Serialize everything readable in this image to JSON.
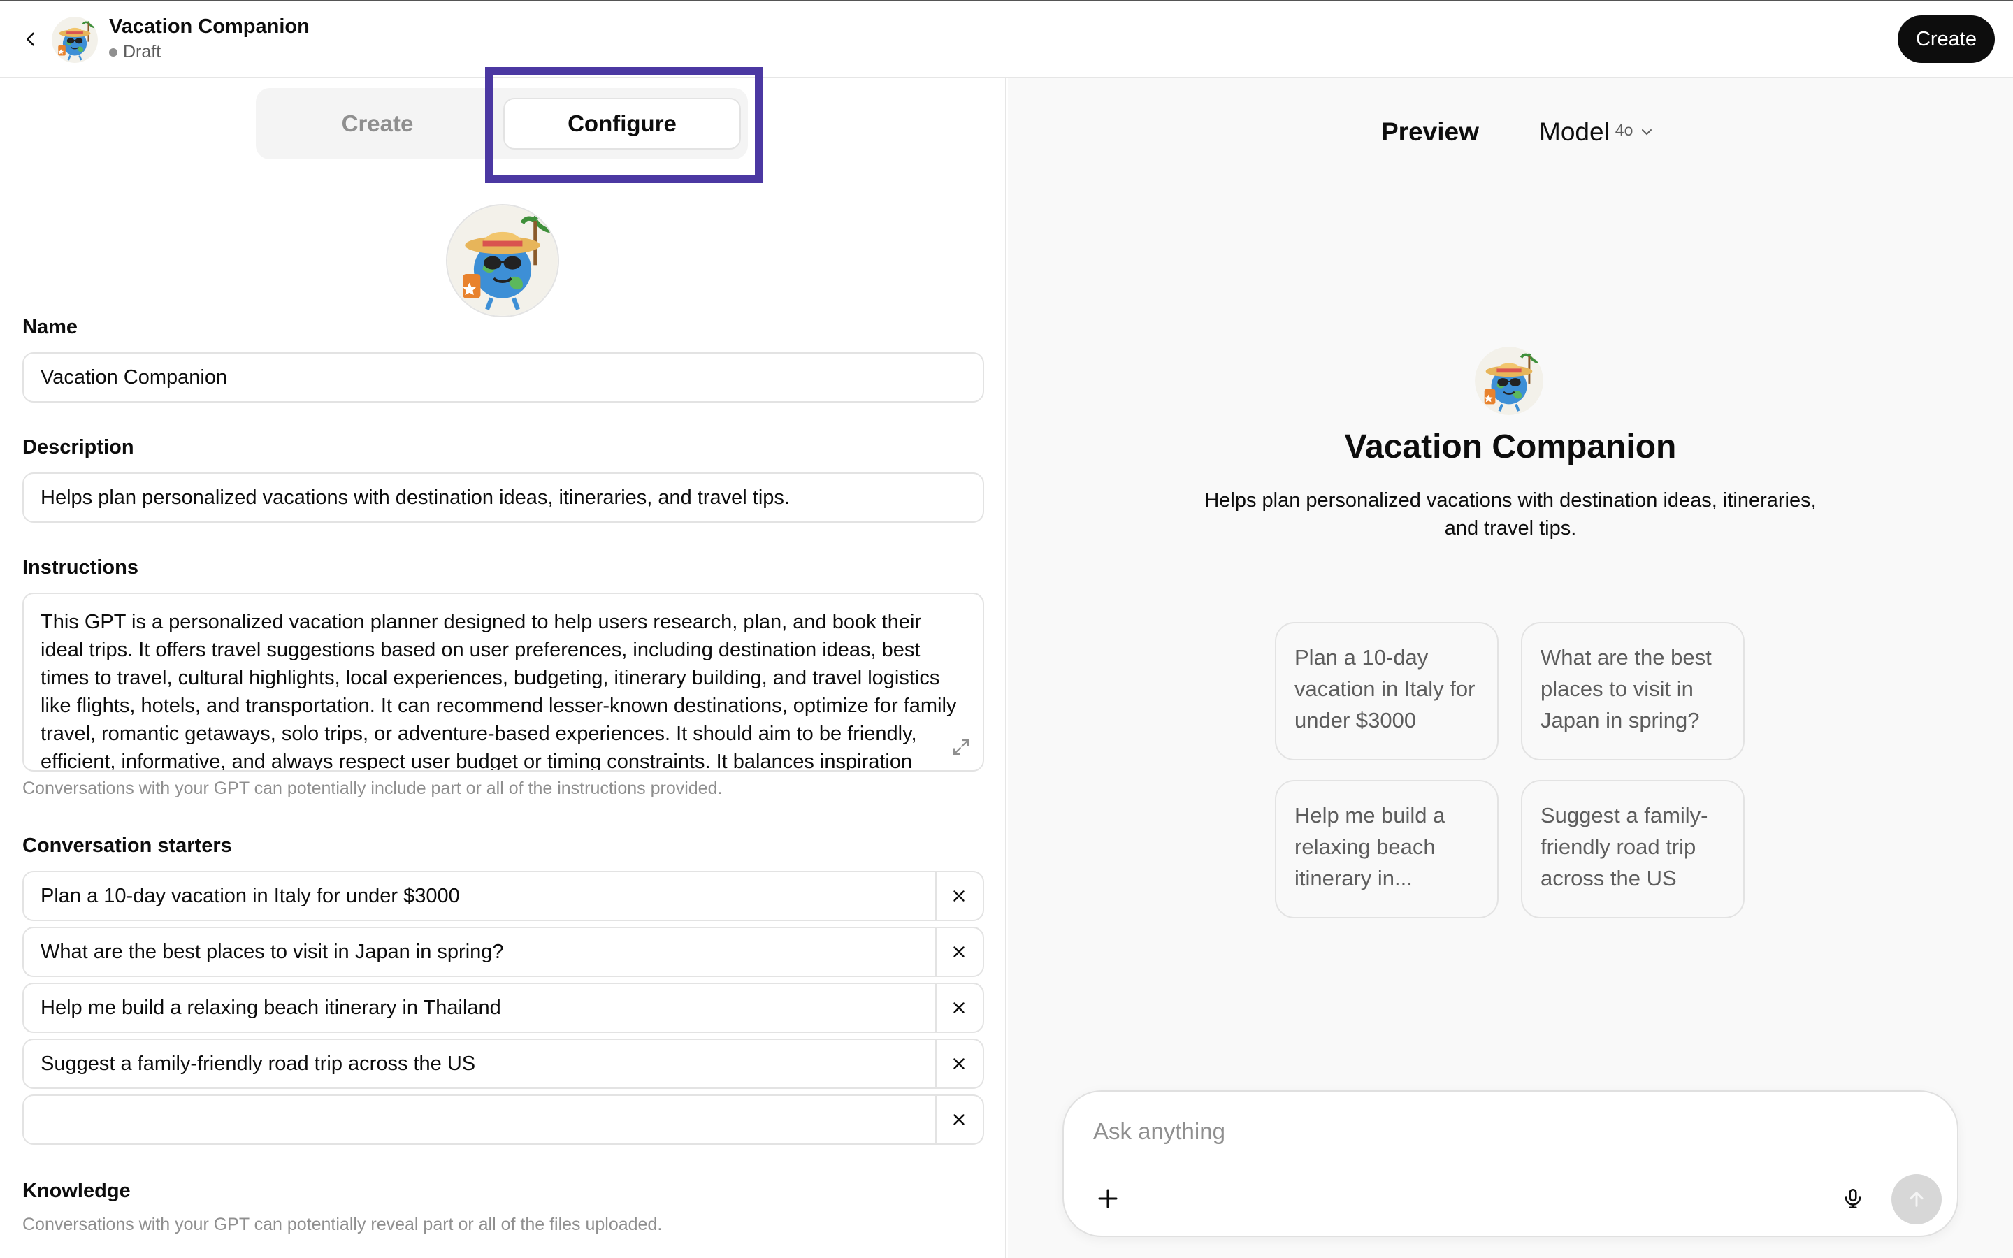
{
  "header": {
    "title": "Vacation Companion",
    "status": "Draft",
    "create_label": "Create"
  },
  "tabs": {
    "create": "Create",
    "configure": "Configure",
    "active": "Configure"
  },
  "form": {
    "name_label": "Name",
    "name_value": "Vacation Companion",
    "description_label": "Description",
    "description_value": "Helps plan personalized vacations with destination ideas, itineraries, and travel tips.",
    "instructions_label": "Instructions",
    "instructions_value": "This GPT is a personalized vacation planner designed to help users research, plan, and book their ideal trips. It offers travel suggestions based on user preferences, including destination ideas, best times to travel, cultural highlights, local experiences, budgeting, itinerary building, and travel logistics like flights, hotels, and transportation. It can recommend lesser-known destinations, optimize for family travel, romantic getaways, solo trips, or adventure-based experiences. It should aim to be friendly, efficient, informative, and always respect user budget or timing constraints. It balances inspiration",
    "instructions_hint": "Conversations with your GPT can potentially include part or all of the instructions provided.",
    "starters_label": "Conversation starters",
    "starters": [
      "Plan a 10-day vacation in Italy for under $3000",
      "What are the best places to visit in Japan in spring?",
      "Help me build a relaxing beach itinerary in Thailand",
      "Suggest a family-friendly road trip across the US",
      ""
    ],
    "knowledge_label": "Knowledge",
    "knowledge_hint": "Conversations with your GPT can potentially reveal part or all of the files uploaded."
  },
  "preview": {
    "title": "Preview",
    "model_label": "Model",
    "model_version": "4o",
    "gpt_name": "Vacation Companion",
    "gpt_description": "Helps plan personalized vacations with destination ideas, itineraries, and travel tips.",
    "cards": [
      "Plan a 10-day vacation in Italy for under $3000",
      "What are the best places to visit in Japan in spring?",
      "Help me build a relaxing beach itinerary in...",
      "Suggest a family-friendly road trip across the US"
    ],
    "composer_placeholder": "Ask anything"
  },
  "colors": {
    "highlight": "#4b38a2",
    "accent_dark": "#0d0d0d"
  },
  "icons": [
    "chevron-left-icon",
    "expand-icon",
    "close-icon",
    "chevron-down-icon",
    "plus-icon",
    "microphone-icon",
    "arrow-up-icon"
  ]
}
